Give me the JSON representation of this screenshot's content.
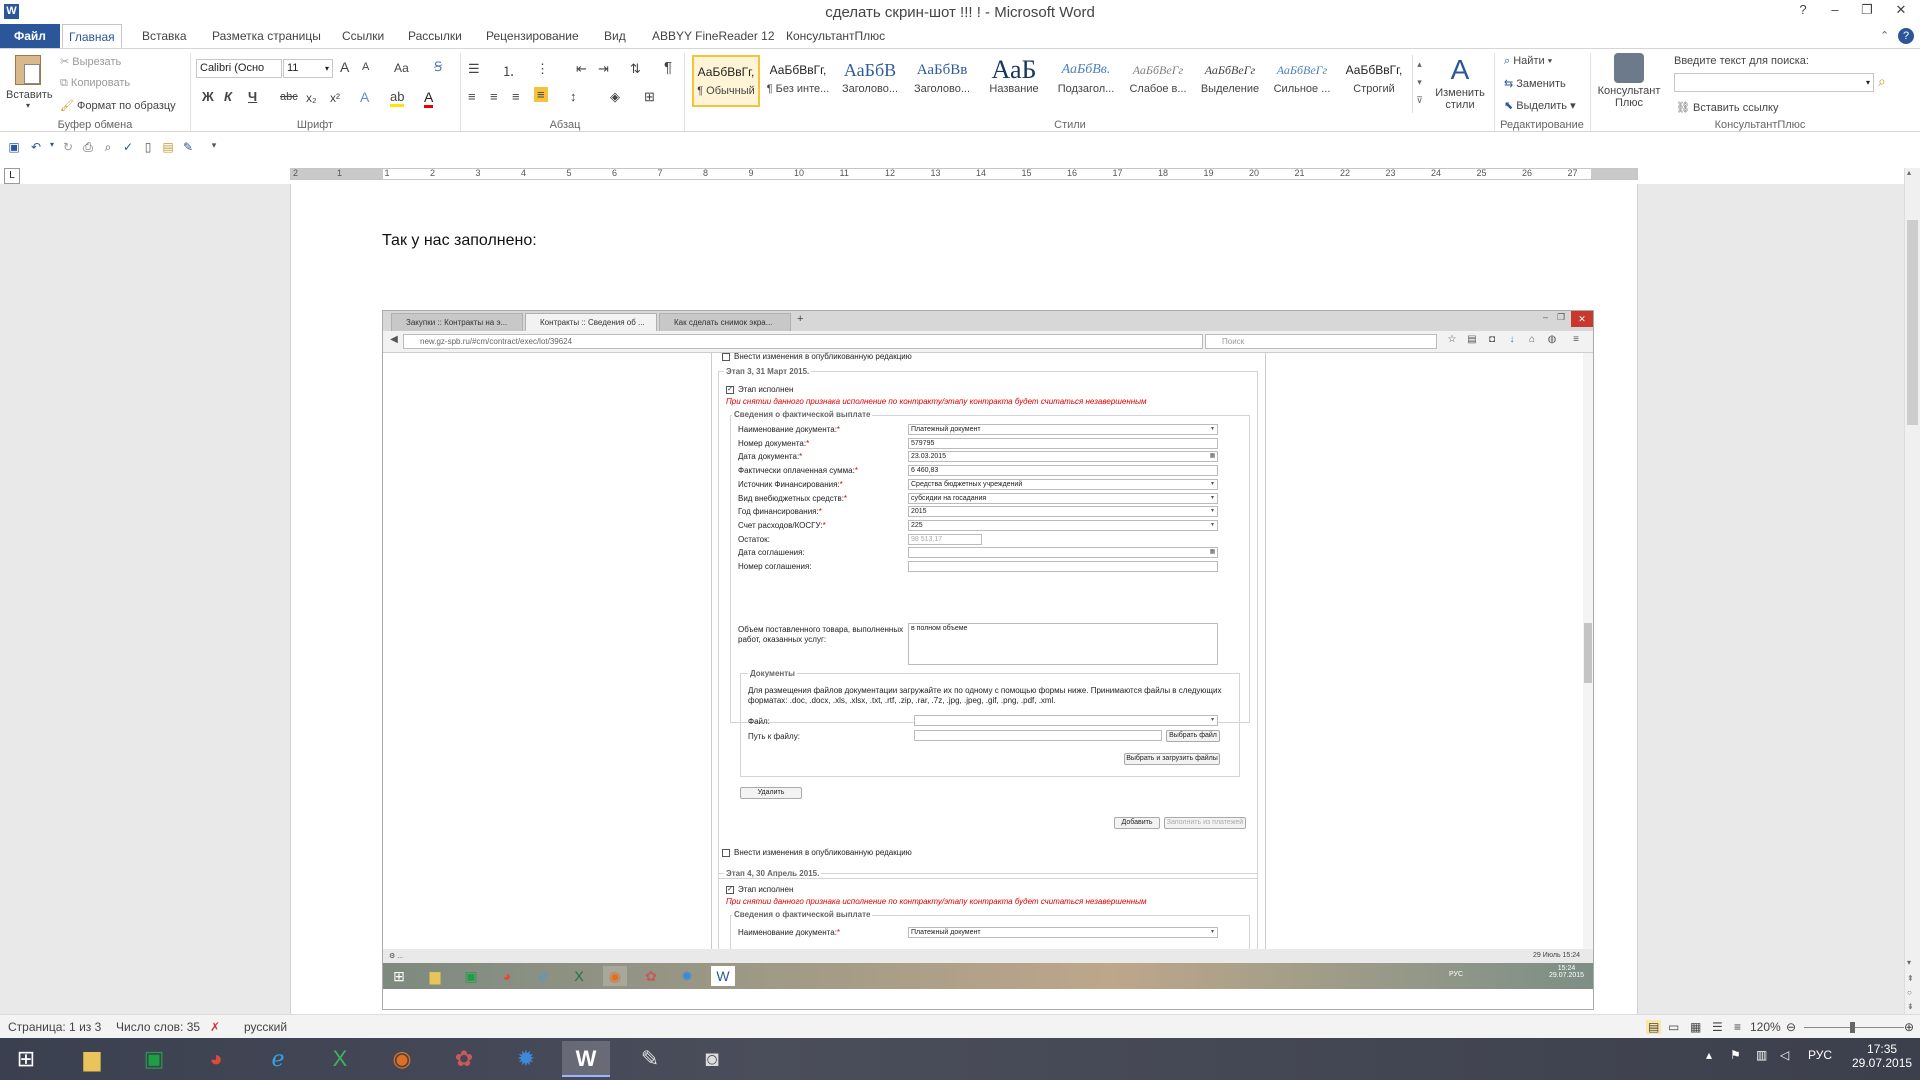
{
  "window": {
    "title": "сделать скрин-шот !!! ! - Microsoft Word",
    "help": "?",
    "minimize": "‒",
    "restore": "❐",
    "close": "✕"
  },
  "ribbon_tabs": [
    "Файл",
    "Главная",
    "Вставка",
    "Разметка страницы",
    "Ссылки",
    "Рассылки",
    "Рецензирование",
    "Вид",
    "ABBYY FineReader 12",
    "КонсультантПлюс"
  ],
  "clipboard": {
    "paste": "Вставить",
    "cut": "Вырезать",
    "copy": "Копировать",
    "format_painter": "Формат по образцу",
    "group": "Буфер обмена"
  },
  "font": {
    "name": "Calibri (Осно",
    "size": "11",
    "group": "Шрифт",
    "bold": "Ж",
    "italic": "К",
    "underline": "Ч",
    "strike": "abc",
    "sub": "x₂",
    "sup": "x²",
    "grow": "A",
    "shrink": "A",
    "case": "Аа"
  },
  "paragraph": {
    "group": "Абзац",
    "pilcrow": "¶"
  },
  "styles": {
    "group": "Стили",
    "items": [
      {
        "sample": "АаБбВвГг,",
        "name": "¶ Обычный"
      },
      {
        "sample": "АаБбВвГг,",
        "name": "¶ Без инте..."
      },
      {
        "sample": "АаБбВ",
        "name": "Заголово..."
      },
      {
        "sample": "АаБбВв",
        "name": "Заголово..."
      },
      {
        "sample": "АаБ",
        "name": "Название"
      },
      {
        "sample": "АаБбВв.",
        "name": "Подзагол..."
      },
      {
        "sample": "АаБбВеГг",
        "name": "Слабое в..."
      },
      {
        "sample": "АаБбВеГг",
        "name": "Выделение"
      },
      {
        "sample": "АаБбВеГг",
        "name": "Сильное ..."
      },
      {
        "sample": "АаБбВвГг,",
        "name": "Строгий"
      }
    ],
    "change_styles": "Изменить стили"
  },
  "editing": {
    "group": "Редактирование",
    "find": "Найти",
    "replace": "Заменить",
    "select": "Выделить"
  },
  "consultant": {
    "group": "КонсультантПлюс",
    "button": "Консультант Плюс",
    "search_label": "Введите текст для поиска:",
    "insert_link": "Вставить ссылку"
  },
  "ruler_numbers": [
    "2",
    "1",
    "1",
    "2",
    "3",
    "4",
    "5",
    "6",
    "7",
    "8",
    "9",
    "10",
    "11",
    "12",
    "13",
    "14",
    "15",
    "16",
    "17",
    "18",
    "19",
    "20",
    "21",
    "22",
    "23",
    "24",
    "25",
    "26",
    "27"
  ],
  "document": {
    "text": "Так у нас заполнено:"
  },
  "screenshot": {
    "tabs": [
      "Закупки :: Контракты на э...",
      "Контракты :: Сведения об ...",
      "Как сделать снимок экра..."
    ],
    "new_tab": "+",
    "url": "new.gz-spb.ru/#cm/contract/exec/lot/39624",
    "search_placeholder": "Поиск",
    "top_checkbox_label": "Внести изменения в опубликованную редакцию",
    "stage3": {
      "title": "Этап 3, 31 Март 2015.",
      "completed": "Этап исполнен",
      "warning": "При снятии данного признака исполнение по контракту/этапу контракта будет считаться незавершенным",
      "payment_title": "Сведения о фактической выплате",
      "fields": [
        {
          "label": "Наименование документа:",
          "req": "*",
          "value": "Платежный документ",
          "type": "select"
        },
        {
          "label": "Номер документа:",
          "req": "*",
          "value": "579795",
          "type": "text"
        },
        {
          "label": "Дата документа:",
          "req": "*",
          "value": "23.03.2015",
          "type": "date"
        },
        {
          "label": "Фактически оплаченная сумма:",
          "req": "*",
          "value": "6 460,83",
          "type": "text"
        },
        {
          "label": "Источник Финансирования:",
          "req": "*",
          "value": "Средства бюджетных учреждений",
          "type": "select"
        },
        {
          "label": "Вид внебюджетных средств:",
          "req": "*",
          "value": "субсидии на госадания",
          "type": "select"
        },
        {
          "label": "Год финансирования:",
          "req": "*",
          "value": "2015",
          "type": "select"
        },
        {
          "label": "Счет расходов/КОСГУ:",
          "req": "*",
          "value": "225",
          "type": "select"
        },
        {
          "label": "Остаток:",
          "req": "",
          "value": "98 513,17",
          "type": "readonly"
        },
        {
          "label": "Дата соглашения:",
          "req": "",
          "value": "",
          "type": "date"
        },
        {
          "label": "Номер соглашения:",
          "req": "",
          "value": "",
          "type": "text"
        }
      ],
      "volume_label": "Объем поставленного товара, выполненных работ, оказанных услуг:",
      "volume_value": "в полном объеме",
      "docs_title": "Документы",
      "docs_text": "Для размещения файлов документации загружайте их по одному с помощью формы ниже. Принимаются файлы в следующих форматах: .doc, .docx, .xls, .xlsx, .txt, .rtf, .zip, .rar, .7z, .jpg, .jpeg, .gif, .png, .pdf, .xml.",
      "file_label": "Файл:",
      "path_label": "Путь к файлу:",
      "choose_file": "Выбрать файл",
      "choose_upload": "Выбрать и загрузить файлы",
      "delete": "Удалить",
      "add": "Добавить",
      "fill_from_payments": "Заполнить из платежей",
      "bottom_checkbox_label": "Внести изменения в опубликованную редакцию"
    },
    "stage4": {
      "title": "Этап 4, 30 Апрель 2015.",
      "completed": "Этап исполнен",
      "warning": "При снятии данного признака исполнение по контракту/этапу контракта будет считаться незавершенным",
      "payment_title": "Сведения о фактической выплате",
      "doc_label": "Наименование документа:",
      "req": "*",
      "doc_value": "Платежный документ"
    },
    "status_left": "⚙ ...",
    "status_right": "29 Июль 15:24",
    "taskbar_lang": "РУС",
    "taskbar_time": "15:24",
    "taskbar_date": "29.07.2015"
  },
  "statusbar": {
    "page": "Страница: 1 из 3",
    "words": "Число слов: 35",
    "lang": "русский",
    "zoom": "120%"
  },
  "taskbar": {
    "lang": "РУС",
    "time": "17:35",
    "date": "29.07.2015"
  }
}
